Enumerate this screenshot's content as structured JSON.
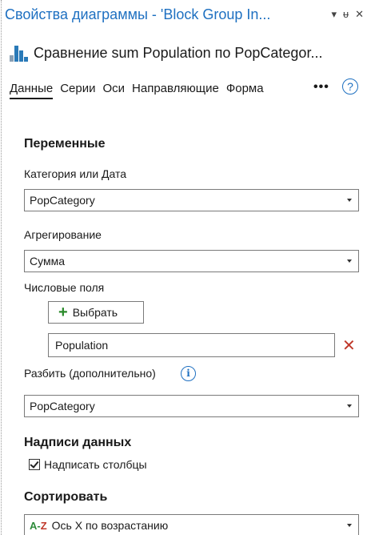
{
  "window": {
    "title": "Свойства диаграммы - 'Block Group In...",
    "menu_glyph": "▾",
    "pin_glyph": "ᵾ",
    "close_glyph": "✕"
  },
  "chart": {
    "title": "Сравнение sum Population по PopCategor..."
  },
  "tabs": [
    {
      "label": "Данные",
      "active": true
    },
    {
      "label": "Серии"
    },
    {
      "label": "Оси"
    },
    {
      "label": "Направляющие"
    },
    {
      "label": "Форма"
    }
  ],
  "tabs_more": "•••",
  "help_glyph": "?",
  "variables": {
    "section_title": "Переменные",
    "category_label": "Категория или Дата",
    "category_value": "PopCategory",
    "aggregation_label": "Агрегирование",
    "aggregation_value": "Сумма",
    "numeric_label": "Числовые поля",
    "select_button": "Выбрать",
    "field_value": "Population",
    "split_label": "Разбить (дополнительно)",
    "split_value": "PopCategory",
    "info_glyph": "i"
  },
  "data_labels": {
    "section_title": "Надписи данных",
    "checkbox_label": "Надписать столбцы",
    "checked": true
  },
  "sort": {
    "section_title": "Сортировать",
    "badge_a": "A-",
    "badge_z": "Z",
    "value": "Ось X по возрастанию"
  },
  "colors": {
    "accent": "#1e70c1",
    "remove": "#c0392b",
    "add": "#2a8a2a"
  }
}
